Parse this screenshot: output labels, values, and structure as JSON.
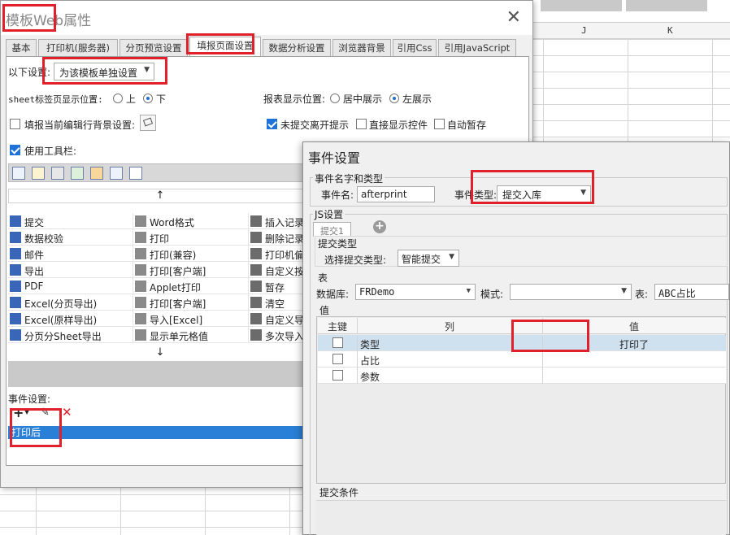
{
  "sheet": {
    "col_j": "J",
    "col_k": "K"
  },
  "main": {
    "title": "模板Web属性",
    "close": "✕",
    "tabs": [
      "基本",
      "打印机(服务器)",
      "分页预览设置",
      "填报页面设置",
      "数据分析设置",
      "浏览器背景",
      "引用Css",
      "引用JavaScript"
    ],
    "active_tab": "填报页面设置",
    "settings_label": "以下设置:",
    "settings_value": "为该模板单独设置",
    "sheet_pos_label": "sheet标签页显示位置:",
    "sheet_pos_options": [
      "上",
      "下"
    ],
    "report_pos_label": "报表显示位置:",
    "report_pos_options": [
      "居中展示",
      "左展示"
    ],
    "fill_bg_label": "填报当前编辑行背景设置:",
    "unsubmit_label": "未提交离开提示",
    "direct_ctrl_label": "直接显示控件",
    "autosave_label": "自动暂存",
    "toolbar_label": "使用工具栏:",
    "up_arrow": "↑",
    "down_arrow": "↓",
    "buttons": [
      [
        "提交",
        "Word格式",
        "插入记录"
      ],
      [
        "数据校验",
        "打印",
        "删除记录"
      ],
      [
        "邮件",
        "打印(兼容)",
        "打印机偏"
      ],
      [
        "导出",
        "打印[客户端]",
        "自定义按"
      ],
      [
        "PDF",
        "Applet打印",
        "暂存"
      ],
      [
        "Excel(分页导出)",
        "打印[客户端]",
        "清空"
      ],
      [
        "Excel(原样导出)",
        "导入[Excel]",
        "自定义导"
      ],
      [
        "分页分Sheet导出",
        "显示单元格值",
        "多次导入"
      ]
    ],
    "event_label": "事件设置:",
    "event_item": "打印后",
    "add_icon": "+",
    "delete_icon": "✕"
  },
  "event_dialog": {
    "title": "事件设置",
    "name_type_group": "事件名字和类型",
    "event_name_label": "事件名:",
    "event_name_value": "afterprint",
    "event_type_label": "事件类型:",
    "event_type_value": "提交入库",
    "js_group": "JS设置",
    "subtab": "提交1",
    "submit_type_group": "提交类型",
    "choose_type_label": "选择提交类型:",
    "choose_type_value": "智能提交",
    "table_group": "表",
    "db_label": "数据库:",
    "db_value": "FRDemo",
    "mode_label": "模式:",
    "table_label": "表:",
    "table_value": "ABC占比",
    "value_group": "值",
    "columns": [
      "主键",
      "列",
      "值"
    ],
    "rows": [
      {
        "col": "类型",
        "val": "打印了"
      },
      {
        "col": "占比",
        "val": ""
      },
      {
        "col": "参数",
        "val": ""
      }
    ],
    "condition_label": "提交条件"
  }
}
